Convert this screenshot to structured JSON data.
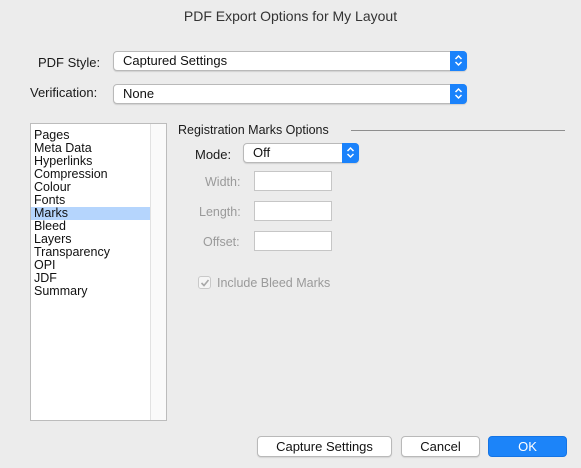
{
  "window": {
    "title": "PDF Export Options for My Layout"
  },
  "pdf_style": {
    "label": "PDF Style:",
    "value": "Captured Settings"
  },
  "verification": {
    "label": "Verification:",
    "value": "None"
  },
  "sidebar": {
    "items": [
      {
        "label": "Pages",
        "selected": false
      },
      {
        "label": "Meta Data",
        "selected": false
      },
      {
        "label": "Hyperlinks",
        "selected": false
      },
      {
        "label": "Compression",
        "selected": false
      },
      {
        "label": "Colour",
        "selected": false
      },
      {
        "label": "Fonts",
        "selected": false
      },
      {
        "label": "Marks",
        "selected": true
      },
      {
        "label": "Bleed",
        "selected": false
      },
      {
        "label": "Layers",
        "selected": false
      },
      {
        "label": "Transparency",
        "selected": false
      },
      {
        "label": "OPI",
        "selected": false
      },
      {
        "label": "JDF",
        "selected": false
      },
      {
        "label": "Summary",
        "selected": false
      }
    ]
  },
  "marks": {
    "group_title": "Registration Marks Options",
    "mode_label": "Mode:",
    "mode_value": "Off",
    "width_label": "Width:",
    "width_value": "",
    "length_label": "Length:",
    "length_value": "",
    "offset_label": "Offset:",
    "offset_value": "",
    "include_bleed_label": "Include Bleed Marks",
    "include_bleed_checked": true,
    "enabled": false
  },
  "buttons": {
    "capture": "Capture Settings",
    "cancel": "Cancel",
    "ok": "OK"
  },
  "colors": {
    "accent": "#1a82fb",
    "selection": "#b5d5fd",
    "disabled_text": "#9a9a9a"
  }
}
